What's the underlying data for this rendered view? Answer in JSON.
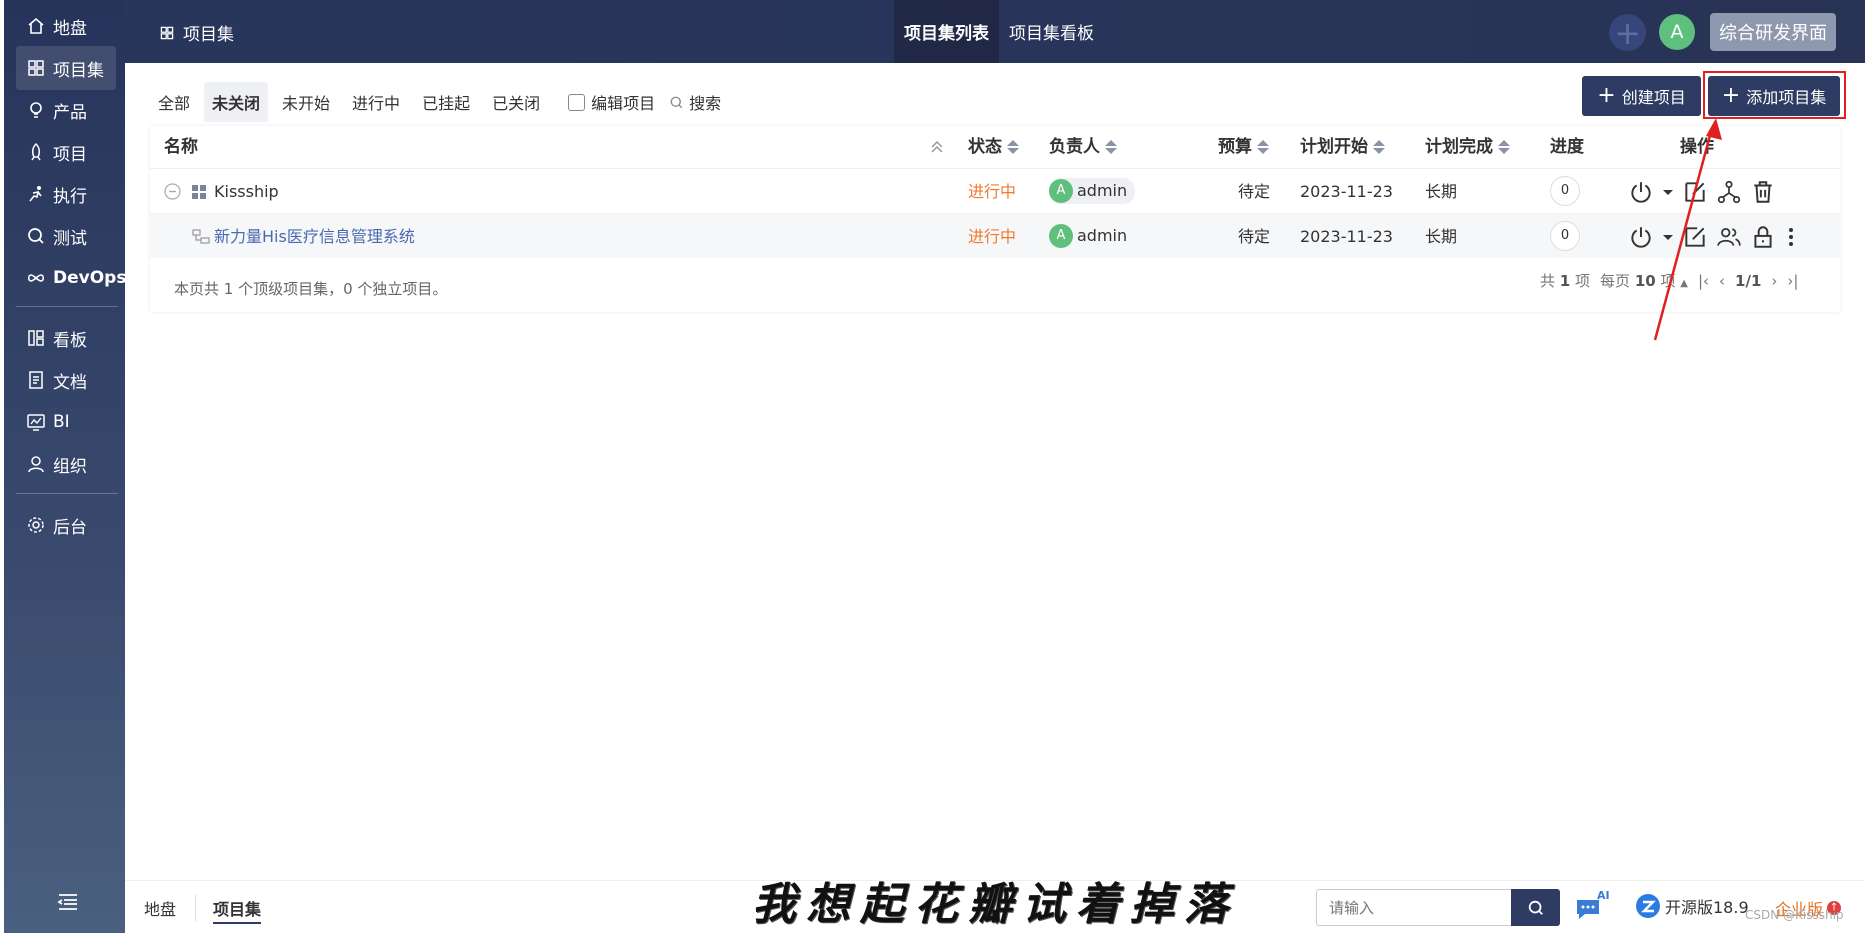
{
  "sidebar": {
    "items": [
      {
        "label": "地盘",
        "icon": "home-icon"
      },
      {
        "label": "项目集",
        "icon": "grid-icon"
      },
      {
        "label": "产品",
        "icon": "bulb-icon"
      },
      {
        "label": "项目",
        "icon": "rocket-icon"
      },
      {
        "label": "执行",
        "icon": "run-icon"
      },
      {
        "label": "测试",
        "icon": "search-icon"
      },
      {
        "label": "DevOps",
        "icon": "infinity-icon"
      },
      {
        "label": "看板",
        "icon": "kanban-icon"
      },
      {
        "label": "文档",
        "icon": "doc-icon"
      },
      {
        "label": "BI",
        "icon": "chart-icon"
      },
      {
        "label": "组织",
        "icon": "users-icon"
      },
      {
        "label": "后台",
        "icon": "gear-icon"
      }
    ]
  },
  "header": {
    "breadcrumb": "项目集",
    "tabs": [
      "项目集列表",
      "项目集看板"
    ],
    "avatar": "A",
    "mode": "综合研发界面"
  },
  "toolbar": {
    "filters": [
      "全部",
      "未关闭",
      "未开始",
      "进行中",
      "已挂起",
      "已关闭"
    ],
    "edit_label": "编辑项目",
    "search_label": "搜索",
    "create_label": "创建项目",
    "add_label": "添加项目集"
  },
  "table": {
    "headers": {
      "name": "名称",
      "status": "状态",
      "owner": "负责人",
      "budget": "预算",
      "start": "计划开始",
      "end": "计划完成",
      "progress": "进度",
      "actions": "操作"
    },
    "rows": [
      {
        "name": "Kissship",
        "status": "进行中",
        "owner_avatar": "A",
        "owner": "admin",
        "budget": "待定",
        "start": "2023-11-23",
        "end": "长期",
        "progress": "0"
      },
      {
        "name": "新力量His医疗信息管理系统",
        "status": "进行中",
        "owner_avatar": "A",
        "owner": "admin",
        "budget": "待定",
        "start": "2023-11-23",
        "end": "长期",
        "progress": "0"
      }
    ],
    "summary": "本页共 1 个顶级项目集，0 个独立项目。",
    "pager": {
      "total_prefix": "共",
      "total": "1",
      "total_suffix": "项",
      "per_prefix": "每页",
      "per": "10",
      "per_suffix": "项",
      "page": "1/1"
    }
  },
  "footer": {
    "tabs": [
      "地盘",
      "项目集"
    ],
    "search_placeholder": "请输入",
    "ai_label": "AI",
    "version": "开源版18.9",
    "enterprise": "企业版",
    "watermark": "CSDN @Kissship",
    "caption": "我想起花瓣试着掉落"
  }
}
